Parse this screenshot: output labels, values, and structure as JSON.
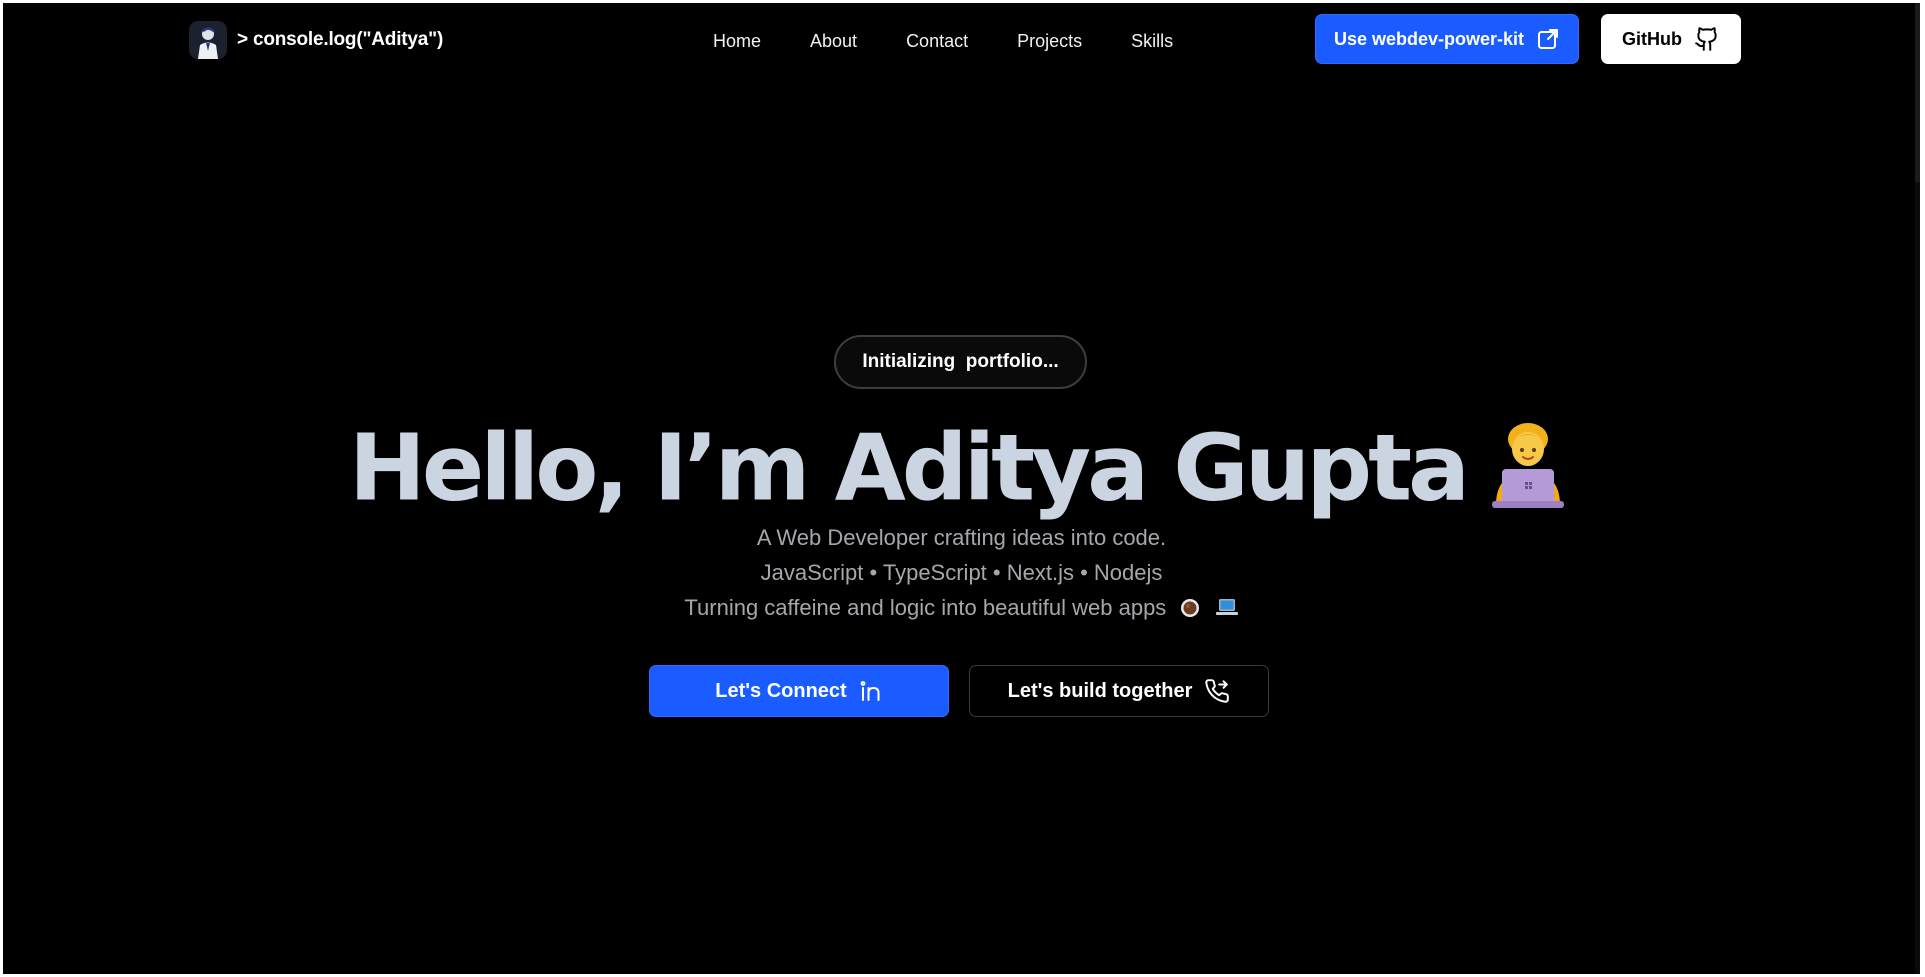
{
  "brand": {
    "text": "> console.log(\"Aditya\")",
    "avatar_alt": "avatar"
  },
  "nav": {
    "links": [
      "Home",
      "About",
      "Contact",
      "Projects",
      "Skills"
    ]
  },
  "actions": {
    "kit_label": "Use webdev-power-kit",
    "kit_icon": "external-link-icon",
    "github_label": "GitHub",
    "github_icon": "github-icon"
  },
  "hero": {
    "status": "Initializing  portfolio...",
    "headline": "Hello, I’m Aditya Gupta",
    "headline_emoji": "technologist-emoji",
    "lines": [
      "A Web Developer crafting ideas into code.",
      "JavaScript • TypeScript • Next.js • Nodejs",
      "Turning caffeine and logic into beautiful web apps"
    ],
    "line3_emojis": [
      "coffee-emoji",
      "laptop-emoji"
    ]
  },
  "cta": {
    "connect_label": "Let's Connect",
    "connect_icon": "linkedin-icon",
    "build_label": "Let's build together",
    "build_icon": "phone-forward-icon"
  },
  "colors": {
    "background": "#000000",
    "accent": "#1a5cff",
    "headline": "#cbd5e1",
    "subtext": "#a6a6ad"
  }
}
